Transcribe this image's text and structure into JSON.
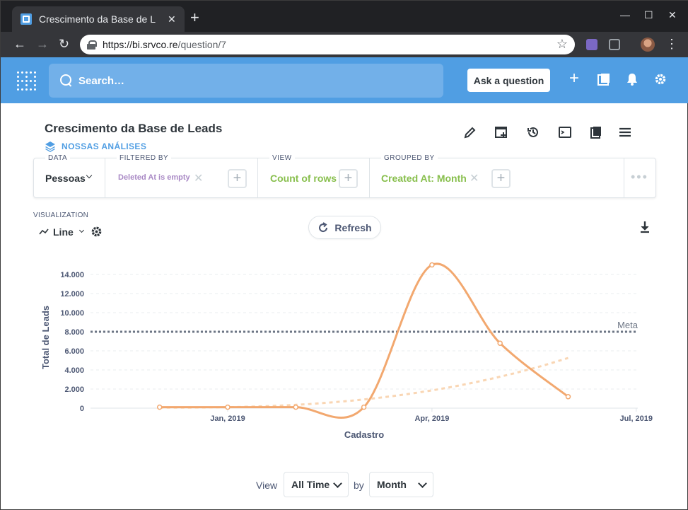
{
  "browser": {
    "tab_title": "Crescimento da Base de L",
    "url_host": "https://bi.srvco.re",
    "url_path": "/question/7"
  },
  "nav": {
    "search_placeholder": "Search…",
    "ask_label": "Ask a question",
    "brand_color": "#509ee3"
  },
  "question": {
    "title": "Crescimento da Base de Leads",
    "collection": "NOSSAS ANÁLISES"
  },
  "query": {
    "data_label": "DATA",
    "data_value": "Pessoas",
    "filter_label": "FILTERED BY",
    "filter_value": "Deleted At is empty",
    "view_label": "VIEW",
    "view_value": "Count of rows",
    "grouped_label": "GROUPED BY",
    "grouped_value": "Created At: Month"
  },
  "viz": {
    "label": "VISUALIZATION",
    "type": "Line",
    "refresh": "Refresh"
  },
  "chart_data": {
    "type": "line",
    "xlabel": "Cadastro",
    "ylabel": "Total de Leads",
    "x_ticks": [
      "Jan, 2019",
      "Apr, 2019",
      "Jul, 2019"
    ],
    "y_ticks": [
      "0",
      "2.000",
      "4.000",
      "6.000",
      "8.000",
      "10.000",
      "12.000",
      "14.000"
    ],
    "ylim": [
      0,
      14000
    ],
    "goal": {
      "label": "Meta",
      "value": 8000
    },
    "series": [
      {
        "x": [
          "2018-12",
          "2019-01",
          "2019-02",
          "2019-03",
          "2019-04",
          "2019-05",
          "2019-06"
        ],
        "values": [
          100,
          100,
          100,
          100,
          15000,
          6800,
          1200
        ],
        "color": "#f2a86f"
      }
    ],
    "trend_color": "#f9d6b4",
    "grid": true
  },
  "footer": {
    "view_label": "View",
    "range": "All Time",
    "by_label": "by",
    "unit": "Month"
  }
}
